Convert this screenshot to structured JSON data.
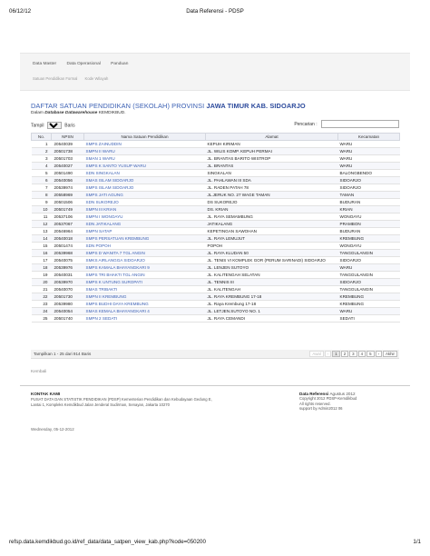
{
  "print_header": {
    "date": "06/12/12",
    "title": "Data Referensi - PDSP"
  },
  "nav": [
    "Data Master",
    "Data Operasional",
    "Panduan"
  ],
  "breadcrumb": [
    "Satuan Pendidikan Formal",
    "Kode Wilayah"
  ],
  "page": {
    "title_prefix": "DAFTAR SATUAN PENDIDIKAN (SEKOLAH) PROVINSI",
    "title_bold": "JAWA TIMUR KAB. SIDOARJO",
    "subtitle_prefix": "Dalam",
    "subtitle_db": "Database Datawarehouse",
    "subtitle_suffix": "KEMDIKBUD."
  },
  "controls": {
    "show_label": "Tampil",
    "show_value": "25",
    "show_suffix": "Baris",
    "search_label": "Pencarian :",
    "search_value": ""
  },
  "table": {
    "columns": [
      "No.",
      "NPSN",
      "Nama Satuan Pendidikan",
      "Alamat",
      "Kecamatan"
    ],
    "rows": [
      [
        "1",
        "20540039",
        "SMPS ZAINUDDIN",
        "KEPUH KIRIMAN",
        "WARU"
      ],
      [
        "2",
        "20501738",
        "SMPN II WARU",
        "JL. WILIS KOMP. KEPUH PERMAI",
        "WARU"
      ],
      [
        "3",
        "20501703",
        "SMAN 1 WARU",
        "JL. BRANTAS BARITO WISTROP",
        "WARU"
      ],
      [
        "4",
        "20540027",
        "SMPS K SANTO YUSUP WARU",
        "JL. BRANTAS",
        "WARU"
      ],
      [
        "5",
        "20501490",
        "SDN SINGKALAN",
        "SINGKALAN",
        "BALONGBENDO"
      ],
      [
        "6",
        "20540056",
        "SMAS ISLAM SIDOARJO",
        "JL. PAHLAWAN III SDA",
        "SIDOARJO"
      ],
      [
        "7",
        "20539974",
        "SMPS ISLAM SIDOARJO",
        "JL. RADEN PATAH 78",
        "SIDOARJO"
      ],
      [
        "8",
        "20558969",
        "SMPS JATI AGUNG",
        "JL.JERUK NO. 27 WAGE TAMAN",
        "TAMAN"
      ],
      [
        "9",
        "20501506",
        "SDN SUKOREJO",
        "DS SUKOREJO",
        "BUDURAN"
      ],
      [
        "10",
        "20501749",
        "SMPN III KRIAN",
        "DS. KRIAN",
        "KRIAN"
      ],
      [
        "11",
        "20537106",
        "SMPN I WONOAYU",
        "JL. RAYA SEMAMBUNG",
        "WONOAYU"
      ],
      [
        "12",
        "20537067",
        "SDN JATIKALANG",
        "JATIKALANG",
        "PRAMBON"
      ],
      [
        "13",
        "20546964",
        "SMPN SATAP",
        "KEPETINGAN SAWOHAN",
        "BUDURAN"
      ],
      [
        "14",
        "20540018",
        "SMPS PERSATUAN KREMBUNG",
        "JL. RAYA LEMUJUT",
        "KREMBUNG"
      ],
      [
        "15",
        "20501474",
        "SDN POPOH",
        "POPOH",
        "WONOAYU"
      ],
      [
        "16",
        "20539968",
        "SMPS D WANITA 7 TGL ANGIN",
        "JL. RAYA KLUDAN 50",
        "TANGGULANGIN"
      ],
      [
        "17",
        "20540075",
        "SMKS AIRLANGGA SIDOARJO",
        "JL. TENIS VI KOMPLEK GOR (PERUM SARINADI) SIDOARJO",
        "SIDOARJO"
      ],
      [
        "18",
        "20539976",
        "SMPS KAMALA BHAYANGKARI 9",
        "JL. LENJEN SUTOYO",
        "WARU"
      ],
      [
        "19",
        "20540031",
        "SMPS TRI BHAKTI TGL ANGIN",
        "JL. KALITENGAH SELATAN",
        "TANGGULANGIN"
      ],
      [
        "20",
        "20539970",
        "SMPS K UNTUNG SUROPATI",
        "JL. TENNIS III",
        "SIDOARJO"
      ],
      [
        "21",
        "20540070",
        "SMAS TRIBAKTI",
        "JL. KALITENGAH",
        "TANGGULANGIN"
      ],
      [
        "22",
        "20501730",
        "SMPN II KREMBUNG",
        "JL. RAYA KREMBUNG 17-18",
        "KREMBUNG"
      ],
      [
        "23",
        "20539980",
        "SMPS BUDHI DAYA KREMBUNG",
        "JL. Raya Krembung 17-18",
        "KREMBUNG"
      ],
      [
        "24",
        "20540054",
        "SMAS KEMALA BHAYANGKARI 4",
        "JL. LETJEN.SUTOYO NO. 1",
        "WARU"
      ],
      [
        "25",
        "20501740",
        "SMPN 2 SEDATI",
        "JL. RAYA CEMANDI",
        "SEDATI"
      ]
    ]
  },
  "table_footer": {
    "info": "Tampilkan 1 - 25 dari 914 Baris",
    "pager": [
      "Awal",
      "‹",
      "1",
      "2",
      "3",
      "4",
      "5",
      "›",
      "Akhir"
    ],
    "current_page": "1"
  },
  "back_link": "Kembali",
  "contact": {
    "heading": "KONTAK KAMI",
    "line1": "PUSAT DATA DAN STATISTIK PENDIDIKAN (PDSP) Kementerian Pendidikan dan Kebudayaan Gedung E,",
    "line2": "Lantai 1, Kompleks Kemdikbud Jalan Jenderal Sudirman, Senayan, Jakarta 10270"
  },
  "data_ref": {
    "heading": "Data Referensi",
    "heading_date": "Agustus 2012",
    "line1": "Copyright 2012 PDSP-Kemdikbud",
    "line2": "All rights reserved.",
    "line3": "support by Admin2012 06"
  },
  "stamp": "Wednesday, 05-12-2012",
  "print_footer": {
    "url": "refsp.data.kemdikbud.go.id/ref_data/data_satpen_view_kab.php?kode=050200",
    "page": "1/1"
  }
}
